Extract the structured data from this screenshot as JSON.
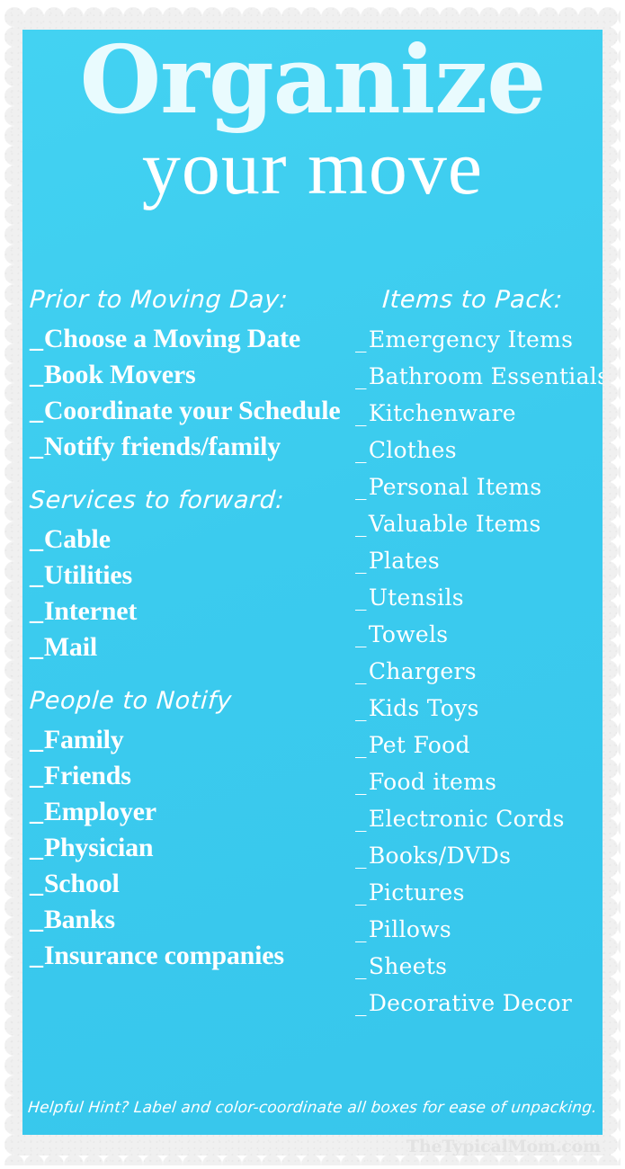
{
  "theme": {
    "panel_color": "#3ECDF0",
    "paper_color": "#F0F0F0",
    "title_color": "#E9FBFE",
    "text_color": "#FFFFFF",
    "watermark_color": "#E2E2E2"
  },
  "header": {
    "title": "Organize",
    "subtitle": "your move"
  },
  "left_column": [
    {
      "heading": "Prior to Moving Day:",
      "items": [
        "Choose a Moving Date",
        "Book Movers",
        "Coordinate your Schedule",
        "Notify friends/family"
      ]
    },
    {
      "heading": "Services to forward:",
      "items": [
        "Cable",
        "Utilities",
        "Internet",
        "Mail"
      ]
    },
    {
      "heading": "People to Notify",
      "items": [
        "Family",
        "Friends",
        "Employer",
        "Physician",
        "School",
        "Banks",
        "Insurance companies"
      ]
    }
  ],
  "right_column": [
    {
      "heading": "Items to Pack:",
      "items": [
        "Emergency Items",
        "Bathroom Essentials",
        "Kitchenware",
        "Clothes",
        "Personal Items",
        "Valuable Items",
        "Plates",
        "Utensils",
        "Towels",
        "Chargers",
        "Kids Toys",
        "Pet Food",
        "Food items",
        "Electronic Cords",
        "Books/DVDs",
        "Pictures",
        "Pillows",
        "Sheets",
        "Decorative Decor"
      ]
    }
  ],
  "checkbox_mark": "_",
  "footer": {
    "hint": "Helpful Hint?  Label and color-coordinate all boxes for ease of unpacking.",
    "watermark": "TheTypicalMom.com"
  }
}
